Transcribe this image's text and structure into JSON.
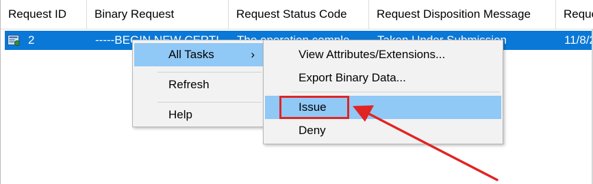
{
  "columns": [
    "Request ID",
    "Binary Request",
    "Request Status Code",
    "Request Disposition Message",
    "Reque"
  ],
  "row": {
    "id": "2",
    "binary": "-----BEGIN NEW CERTI",
    "status": "The operation comple",
    "disposition": "Taken Under Submission",
    "date": "11/8/2"
  },
  "context_menu": {
    "items": [
      {
        "label": "All Tasks",
        "has_submenu": true
      },
      {
        "label": "Refresh"
      },
      {
        "label": "Help"
      }
    ],
    "submenu_arrow": "›"
  },
  "submenu": {
    "items": [
      {
        "label": "View Attributes/Extensions..."
      },
      {
        "label": "Export Binary Data..."
      },
      {
        "label": "Issue",
        "highlighted": true
      },
      {
        "label": "Deny"
      }
    ]
  },
  "colors": {
    "selection": "#0a78d7",
    "menu_highlight": "#90c8f6",
    "annotation": "#e02424"
  }
}
